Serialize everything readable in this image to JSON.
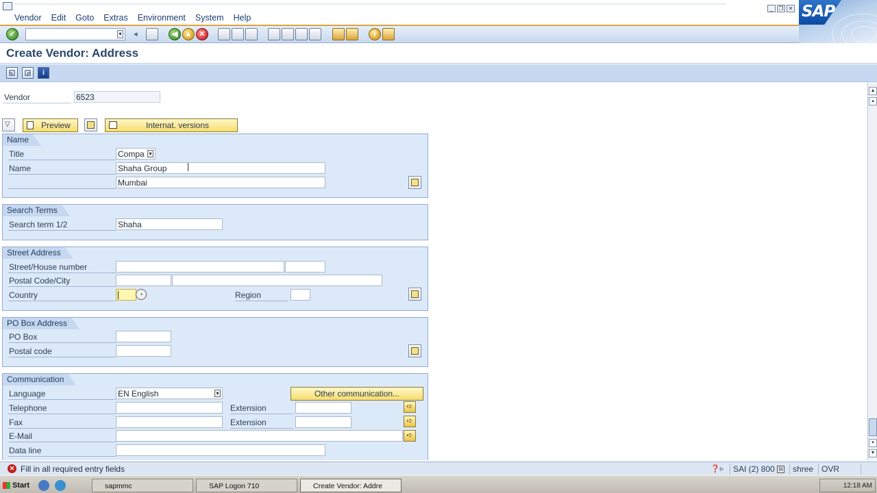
{
  "menu": {
    "items": [
      "Vendor",
      "Edit",
      "Goto",
      "Extras",
      "Environment",
      "System",
      "Help"
    ]
  },
  "window": {
    "title": "Create Vendor: Address",
    "logo": "SAP"
  },
  "header": {
    "vendor_label": "Vendor",
    "vendor_value": "6523"
  },
  "toolbar": {
    "preview_label": "Preview",
    "internat_label": "Internat. versions"
  },
  "name_group": {
    "title": "Name",
    "title_label": "Title",
    "title_value": "Compa",
    "name_label": "Name",
    "name_value": "Shaha Group",
    "name2_value": "Mumbai"
  },
  "search_group": {
    "title": "Search Terms",
    "search_label": "Search term 1/2",
    "search_value": "Shaha"
  },
  "street_group": {
    "title": "Street Address",
    "street_label": "Street/House number",
    "street_value": "",
    "house_value": "",
    "postal_label": "Postal Code/City",
    "postal_value": "",
    "city_value": "",
    "country_label": "Country",
    "country_value": "",
    "region_label": "Region",
    "region_value": ""
  },
  "pobox_group": {
    "title": "PO Box Address",
    "pobox_label": "PO Box",
    "pobox_value": "",
    "postal_label": "Postal code",
    "postal_value": ""
  },
  "comm_group": {
    "title": "Communication",
    "language_label": "Language",
    "language_value": "EN English",
    "other_comm_label": "Other communication...",
    "telephone_label": "Telephone",
    "telephone_value": "",
    "extension_label": "Extension",
    "tel_ext_value": "",
    "fax_label": "Fax",
    "fax_value": "",
    "fax_ext_label": "Extension",
    "fax_ext_value": "",
    "email_label": "E-Mail",
    "email_value": "",
    "dataline_label": "Data line",
    "dataline_value": ""
  },
  "status": {
    "message": "Fill in all required entry fields",
    "system": "SAI (2) 800",
    "server": "shree",
    "mode": "OVR"
  },
  "taskbar": {
    "start": "Start",
    "tasks": [
      "sapmmc",
      "SAP Logon 710",
      "Create Vendor: Addre"
    ],
    "clock": "12:18 AM"
  },
  "colors": {
    "toolbar_accent": "#d9a441",
    "group_background": "#dce9f8",
    "button_yellow": "#f6dd6e",
    "error_red": "#c0201d"
  },
  "icons": [
    "check-icon",
    "back-icon",
    "save-icon",
    "exit-icon",
    "cancel-icon",
    "print-icon",
    "find-icon",
    "help-icon",
    "layout-icon",
    "error-icon"
  ]
}
